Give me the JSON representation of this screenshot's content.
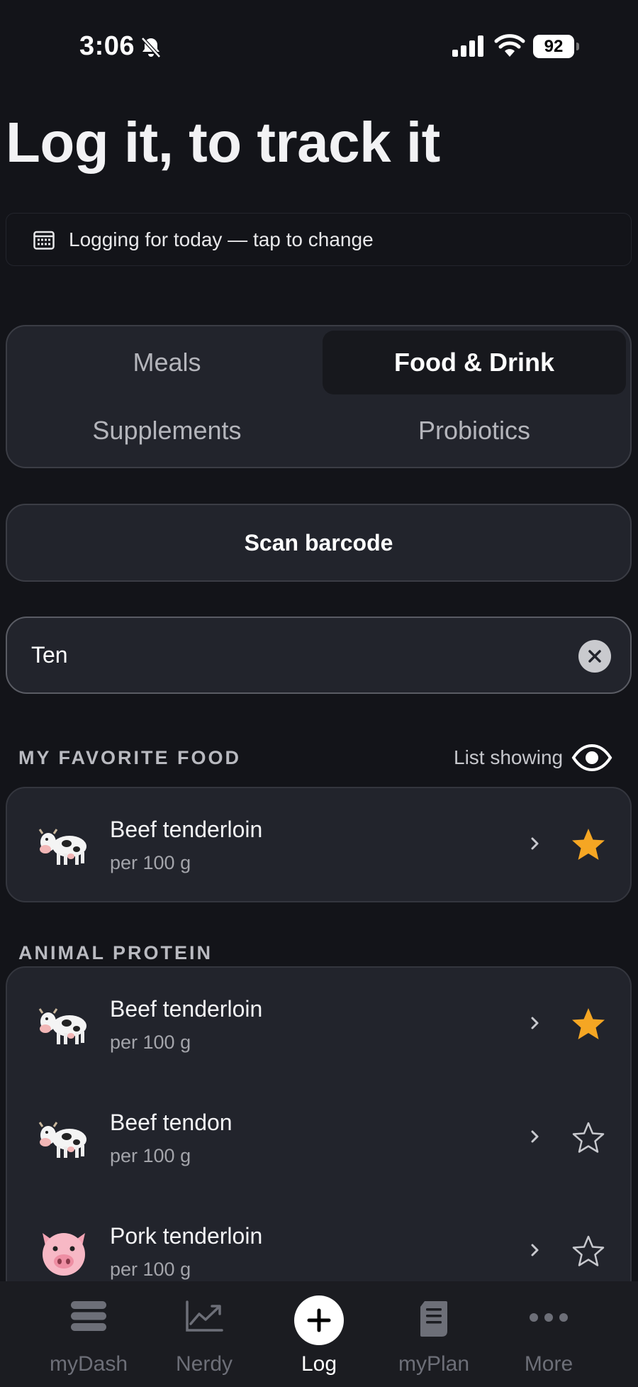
{
  "status_bar": {
    "time": "3:06",
    "battery": "92",
    "icons": [
      "bell-slash-icon",
      "cellular-signal-icon",
      "wifi-icon",
      "battery-icon"
    ]
  },
  "page": {
    "title": "Log it, to track it",
    "date_selector": "Logging for today — tap to change"
  },
  "segments": [
    {
      "label": "Meals",
      "active": false
    },
    {
      "label": "Food & Drink",
      "active": true
    },
    {
      "label": "Supplements",
      "active": false
    },
    {
      "label": "Probiotics",
      "active": false
    }
  ],
  "scan_button": "Scan barcode",
  "search": {
    "value": "Ten",
    "clear_icon": "close-icon"
  },
  "favorites": {
    "header": "MY FAVORITE FOOD",
    "list_toggle_label": "List showing",
    "list_toggle_icon": "eye-icon",
    "items": [
      {
        "emoji": "🐄",
        "name": "Beef tenderloin",
        "unit": "per 100 g",
        "favorite": true
      }
    ]
  },
  "animal_protein": {
    "header": "ANIMAL PROTEIN",
    "items": [
      {
        "emoji": "🐄",
        "name": "Beef tenderloin",
        "unit": "per 100 g",
        "favorite": true
      },
      {
        "emoji": "🐄",
        "name": "Beef tendon",
        "unit": "per 100 g",
        "favorite": false
      },
      {
        "emoji": "🐷",
        "name": "Pork tenderloin",
        "unit": "per 100 g",
        "favorite": false
      }
    ]
  },
  "tab_bar": [
    {
      "label": "myDash",
      "icon": "stack-icon",
      "active": false
    },
    {
      "label": "Nerdy",
      "icon": "chart-line-icon",
      "active": false
    },
    {
      "label": "Log",
      "icon": "plus-circle-icon",
      "active": true
    },
    {
      "label": "myPlan",
      "icon": "document-icon",
      "active": false
    },
    {
      "label": "More",
      "icon": "more-dots-icon",
      "active": false
    }
  ],
  "colors": {
    "background": "#131419",
    "card": "#22242c",
    "star_active": "#f5a623",
    "tab_inactive": "#6d6f78"
  }
}
